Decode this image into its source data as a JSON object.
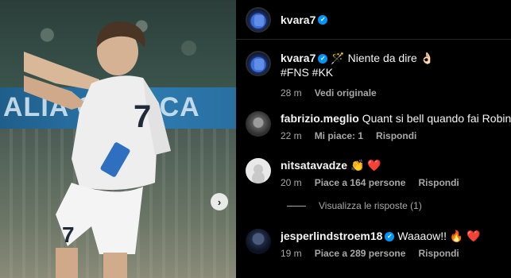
{
  "post_author": {
    "username": "kvara7"
  },
  "carousel": {
    "next_icon": "chevron-right-icon",
    "next_glyph": "›",
    "banner_text": "ALIA  CROCCA"
  },
  "caption": {
    "username": "kvara7",
    "text": "🪄 Niente da dire 👌🏻",
    "hashtags": "#FNS #KK",
    "time": "28 m",
    "see_original": "Vedi originale"
  },
  "comments": [
    {
      "username": "fabrizio.meglio",
      "text": "Quant si bell quando fai Robin Hood",
      "time": "22 m",
      "likes": "Mi piace: 1",
      "reply": "Rispondi"
    },
    {
      "username": "nitsatavadze",
      "text": "👏 ❤️",
      "time": "20 m",
      "likes": "Piace a 164 persone",
      "reply": "Rispondi",
      "view_replies": "Visualizza le risposte (1)"
    },
    {
      "username": "jesperlindstroem18",
      "text": "Waaaow!! 🔥 ❤️",
      "time": "19 m",
      "likes": "Piace a 289 persone",
      "reply": "Rispondi"
    }
  ],
  "colors": {
    "verified": "#0095f6",
    "muted_text": "#a8a8a8",
    "background": "#000000"
  }
}
